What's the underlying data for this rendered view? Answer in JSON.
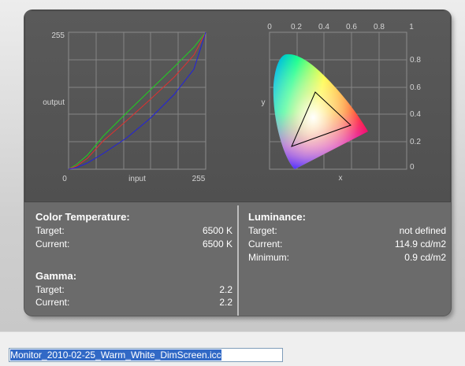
{
  "curves_graph": {
    "y_max": "255",
    "y_label": "output",
    "x_min": "0",
    "x_label": "input",
    "x_max": "255"
  },
  "chroma_graph": {
    "x_ticks": [
      "0",
      "0.2",
      "0.4",
      "0.6",
      "0.8",
      "1"
    ],
    "y_ticks": [
      "0.8",
      "0.6",
      "0.4",
      "0.2",
      "0"
    ],
    "x_label": "x",
    "y_label": "y"
  },
  "color_temperature": {
    "heading": "Color Temperature:",
    "target_label": "Target:",
    "target_value": "6500 K",
    "current_label": "Current:",
    "current_value": "6500 K"
  },
  "gamma": {
    "heading": "Gamma:",
    "target_label": "Target:",
    "target_value": "2.2",
    "current_label": "Current:",
    "current_value": "2.2"
  },
  "luminance": {
    "heading": "Luminance:",
    "target_label": "Target:",
    "target_value": "not defined",
    "current_label": "Current:",
    "current_value": "114.9 cd/m2",
    "minimum_label": "Minimum:",
    "minimum_value": "0.9 cd/m2"
  },
  "profile_file": {
    "value": "Monitor_2010-02-25_Warm_White_DimScreen.icc"
  },
  "colors": {
    "red_curve": "#e03030",
    "green_curve": "#20d020",
    "blue_curve": "#2020e0"
  }
}
